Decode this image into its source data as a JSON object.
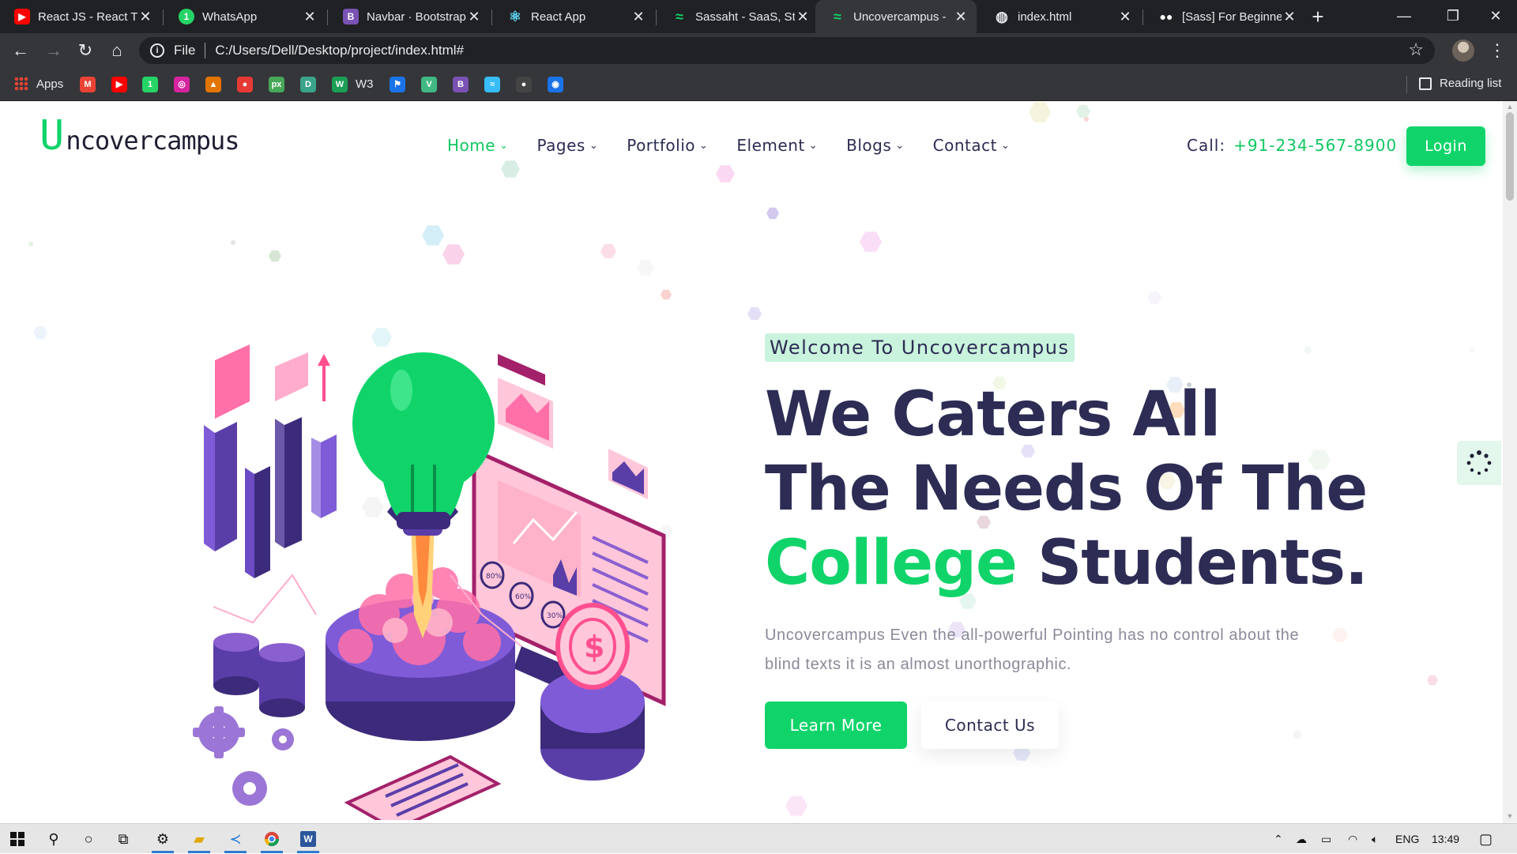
{
  "browser": {
    "tabs": [
      {
        "title": "React JS - React Tu",
        "favicon": "youtube-icon",
        "color": "#ff0000",
        "active": false
      },
      {
        "title": "WhatsApp",
        "favicon": "whatsapp-icon",
        "color": "#25d366",
        "active": false
      },
      {
        "title": "Navbar · Bootstrap",
        "favicon": "bootstrap-icon",
        "color": "#7952b3",
        "active": false
      },
      {
        "title": "React App",
        "favicon": "react-icon",
        "color": "#61dafb",
        "active": false
      },
      {
        "title": "Sassaht - SaaS, Sta",
        "favicon": "sassaht-icon",
        "color": "#10d46a",
        "active": false
      },
      {
        "title": "Uncovercampus - ",
        "favicon": "uncovercampus-icon",
        "color": "#10d46a",
        "active": true
      },
      {
        "title": "index.html",
        "favicon": "globe-icon",
        "color": "#e8eaed",
        "active": false
      },
      {
        "title": "[Sass] For Beginner",
        "favicon": "medium-icon",
        "color": "#ffffff",
        "active": false
      }
    ],
    "address": {
      "scheme_label": "File",
      "url": "C:/Users/Dell/Desktop/project/index.html#"
    },
    "bookmarks": {
      "apps_label": "Apps",
      "w3_label": "W3",
      "reading_list_label": "Reading list",
      "icons": [
        {
          "name": "gmail-icon",
          "glyph": "M",
          "color": "#ea4335"
        },
        {
          "name": "youtube-icon",
          "glyph": "▶",
          "color": "#ff0000"
        },
        {
          "name": "whatsapp-icon",
          "glyph": "1",
          "color": "#25d366"
        },
        {
          "name": "instagram-icon",
          "glyph": "◎",
          "color": "#d6249f"
        },
        {
          "name": "construction-icon",
          "glyph": "▲",
          "color": "#e37400"
        },
        {
          "name": "record-icon",
          "glyph": "●",
          "color": "#e53935"
        },
        {
          "name": "px-icon",
          "glyph": "px",
          "color": "#46a758"
        },
        {
          "name": "d-icon",
          "glyph": "D",
          "color": "#3aa389"
        },
        {
          "name": "webflow-icon",
          "glyph": "W",
          "color": "#1b9e55"
        }
      ],
      "icons_after_w3": [
        {
          "name": "flag-icon",
          "glyph": "⚑",
          "color": "#1a73e8"
        },
        {
          "name": "vue-icon",
          "glyph": "V",
          "color": "#41b883"
        },
        {
          "name": "bootstrap-icon",
          "glyph": "B",
          "color": "#7952b3"
        },
        {
          "name": "tailwind-icon",
          "glyph": "≈",
          "color": "#38bdf8"
        },
        {
          "name": "github-icon",
          "glyph": "●",
          "color": "#444444"
        },
        {
          "name": "robot-icon",
          "glyph": "◉",
          "color": "#1a73e8"
        }
      ]
    }
  },
  "site": {
    "logo": {
      "first": "U",
      "rest": "ncovercampus"
    },
    "nav": [
      {
        "label": "Home",
        "active": true
      },
      {
        "label": "Pages",
        "active": false
      },
      {
        "label": "Portfolio",
        "active": false
      },
      {
        "label": "Element",
        "active": false
      },
      {
        "label": "Blogs",
        "active": false
      },
      {
        "label": "Contact",
        "active": false
      }
    ],
    "call_label": "Call:",
    "phone": "+91-234-567-8900",
    "login_label": "Login",
    "hero": {
      "tag": "Welcome To Uncovercampus",
      "line1": "We Caters All",
      "line2": "The Needs Of The",
      "line3_accent": "College",
      "line3_rest": " Students.",
      "description": "Uncovercampus Even the all-powerful Pointing has no control about the blind texts it is an almost unorthographic.",
      "learn_more": "Learn More",
      "contact_us": "Contact Us",
      "illustration": {
        "pct_1": "80%",
        "pct_2": "60%",
        "pct_3": "30%",
        "currency": "$"
      }
    }
  },
  "taskbar": {
    "language": "ENG",
    "time": "13:49"
  },
  "colors": {
    "accent": "#10d46a",
    "heading": "#2c2c54",
    "muted": "#8a8a9a"
  }
}
